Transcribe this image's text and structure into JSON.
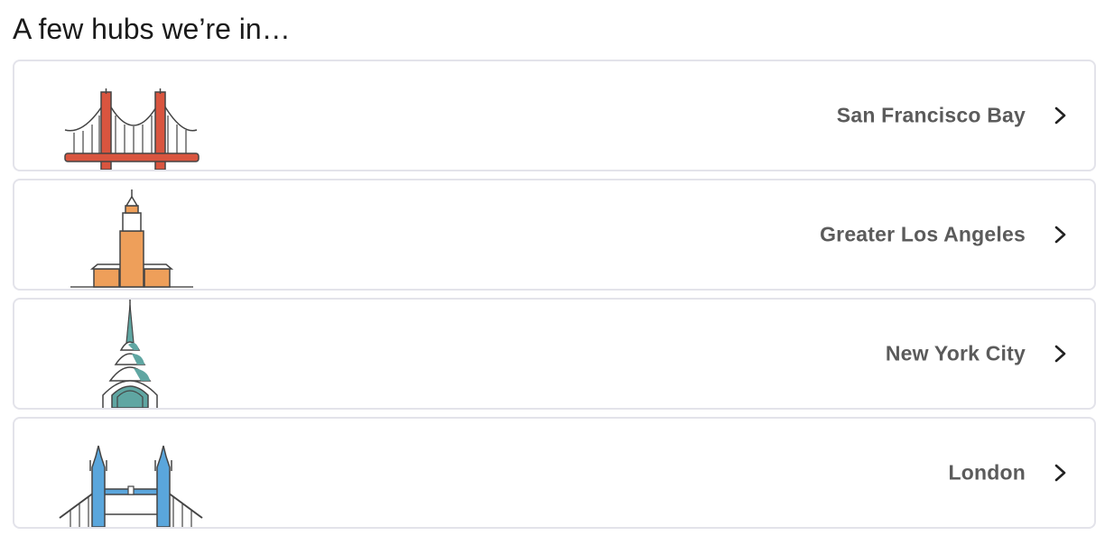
{
  "heading": "A few hubs we’re in…",
  "hubs": [
    {
      "name": "San Francisco Bay",
      "icon": "golden-gate-bridge-icon",
      "color": "#d9553f"
    },
    {
      "name": "Greater Los Angeles",
      "icon": "city-hall-tower-icon",
      "color": "#ee9f5a"
    },
    {
      "name": "New York City",
      "icon": "chrysler-building-icon",
      "color": "#5fa6a2"
    },
    {
      "name": "London",
      "icon": "tower-bridge-icon",
      "color": "#5aa6dc"
    }
  ],
  "chevron_icon": "chevron-right-icon"
}
